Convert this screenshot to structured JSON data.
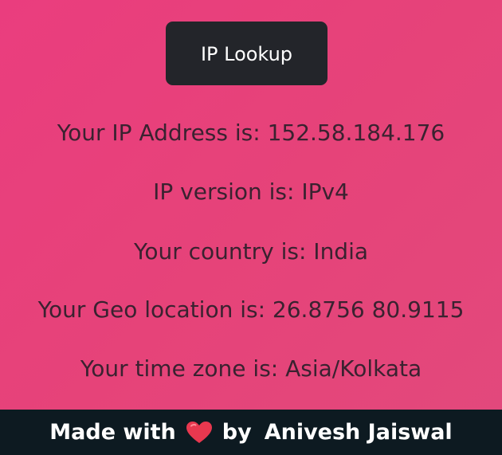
{
  "button": {
    "label": "IP Lookup"
  },
  "info": {
    "ip": "Your IP Address is: 152.58.184.176",
    "version": "IP version is: IPv4",
    "country": "Your country is: India",
    "geo": "Your Geo location is: 26.8756 80.9115",
    "timezone": "Your time zone is: Asia/Kolkata"
  },
  "footer": {
    "made_with": "Made with",
    "heart_icon": "heart-icon",
    "by": "by",
    "author": "Anivesh Jaiswal"
  },
  "colors": {
    "background": "#e64379",
    "button_bg": "#23252a",
    "text": "#3a2230",
    "footer_bg": "#0d1a21",
    "heart": "#e8384f"
  }
}
